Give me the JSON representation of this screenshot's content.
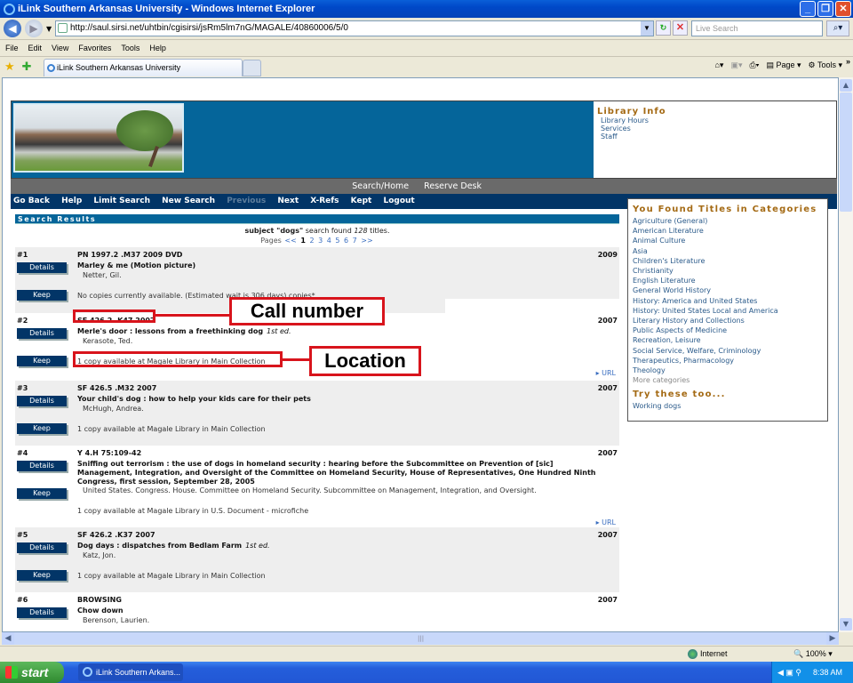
{
  "window": {
    "title": "iLink Southern Arkansas University - Windows Internet Explorer",
    "address": "http://saul.sirsi.net/uhtbin/cgisirsi/jsRm5lm7nG/MAGALE/40860006/5/0",
    "search_placeholder": "Live Search",
    "menu": [
      "File",
      "Edit",
      "View",
      "Favorites",
      "Tools",
      "Help"
    ],
    "tab_label": "iLink Southern Arkansas University",
    "toolbar": {
      "page": "Page",
      "tools": "Tools"
    },
    "status": {
      "zone": "Internet",
      "zoom": "100%"
    }
  },
  "taskbar": {
    "start": "start",
    "task": "iLink Southern Arkans...",
    "clock": "8:38 AM"
  },
  "header": {
    "library_info_title": "Library Info",
    "library_info_links": [
      "Library Hours",
      "Services",
      "Staff"
    ],
    "top_links": [
      "Search/Home",
      "Reserve Desk"
    ],
    "nav": [
      {
        "label": "Go Back",
        "enabled": true
      },
      {
        "label": "Help",
        "enabled": true
      },
      {
        "label": "Limit Search",
        "enabled": true
      },
      {
        "label": "New Search",
        "enabled": true
      },
      {
        "label": "Previous",
        "enabled": false
      },
      {
        "label": "Next",
        "enabled": true
      },
      {
        "label": "X-Refs",
        "enabled": true
      },
      {
        "label": "Kept",
        "enabled": true
      },
      {
        "label": "Logout",
        "enabled": true
      }
    ]
  },
  "results": {
    "heading": "Search Results",
    "summary_prefix": "subject \"dogs\"",
    "summary_mid": " search found ",
    "count": "128",
    "summary_suffix": " titles.",
    "pages_label": "Pages",
    "pages_prev": "<<",
    "pages": [
      "1",
      "2",
      "3",
      "4",
      "5",
      "6",
      "7"
    ],
    "current_page": "1",
    "pages_next": ">>",
    "details_label": "Details",
    "keep_label": "Keep",
    "url_label": "URL",
    "items": [
      {
        "num": "#1",
        "callno": "PN 1997.2 .M37 2009 DVD",
        "title": "Marley & me (Motion picture)",
        "edition": "",
        "author": "Netter, Gil.",
        "avail": "No copies currently available.   (Estimated wait is 306 days) copies*",
        "year": "2009"
      },
      {
        "num": "#2",
        "callno": "SF 426.2 .K47 2007",
        "title": "Merle's door : lessons from a freethinking dog",
        "edition": "1st ed.",
        "author": "Kerasote, Ted.",
        "avail": "1 copy available at Magale Library in Main Collection",
        "year": "2007"
      },
      {
        "num": "#3",
        "callno": "SF 426.5 .M32 2007",
        "title": "Your child's dog : how to help your kids care for their pets",
        "edition": "",
        "author": "McHugh, Andrea.",
        "avail": "1 copy available at Magale Library in Main Collection",
        "year": "2007"
      },
      {
        "num": "#4",
        "callno": "Y 4.H 75:109-42",
        "title": "Sniffing out terrorism : the use of dogs in homeland security : hearing before the Subcommittee on Prevention of [sic] Management, Integration, and Oversight of the Committee on Homeland Security, House of Representatives, One Hundred Ninth Congress, first session, September 28, 2005",
        "edition": "",
        "author": "United States. Congress. House. Committee on Homeland Security. Subcommittee on Management, Integration, and Oversight.",
        "avail": "1 copy available at Magale Library in U.S. Document - microfiche",
        "year": "2007"
      },
      {
        "num": "#5",
        "callno": "SF 426.2 .K37 2007",
        "title": "Dog days : dispatches from Bedlam Farm",
        "edition": "1st ed.",
        "author": "Katz, Jon.",
        "avail": "1 copy available at Magale Library in Main Collection",
        "year": "2007"
      },
      {
        "num": "#6",
        "callno": "BROWSING",
        "title": "Chow down",
        "edition": "",
        "author": "Berenson, Laurien.",
        "avail": "",
        "year": "2007"
      }
    ]
  },
  "categories": {
    "title": "You Found Titles in Categories",
    "items": [
      "Agriculture (General)",
      "American Literature",
      "Animal Culture",
      "Asia",
      "Children's Literature",
      "Christianity",
      "English Literature",
      "General World History",
      "History: America and United States",
      "History: United States Local and America",
      "Literary History and Collections",
      "Public Aspects of Medicine",
      "Recreation, Leisure",
      "Social Service, Welfare, Criminology",
      "Therapeutics, Pharmacology",
      "Theology"
    ],
    "more": "More categories",
    "try_title": "Try these too...",
    "try_items": [
      "Working dogs"
    ]
  },
  "annotations": {
    "call_number": "Call number",
    "location": "Location"
  },
  "colors": {
    "brand_blue": "#05659a",
    "nav_navy": "#023567",
    "heading_gold": "#a46a14",
    "annotation_red": "#d8141c"
  }
}
